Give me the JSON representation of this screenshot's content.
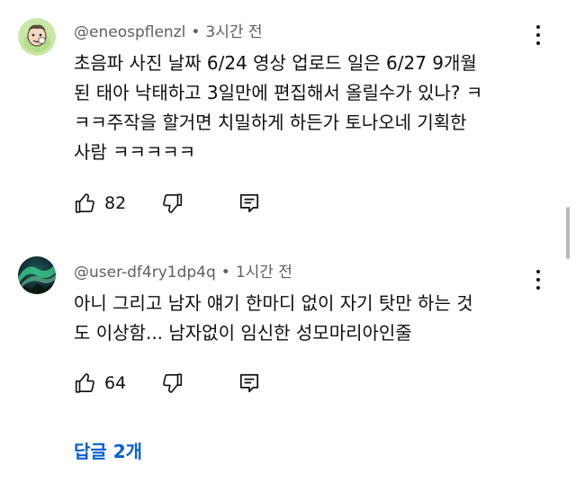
{
  "comments": [
    {
      "author": "@eneospflenzl",
      "separator": "•",
      "time": "3시간 전",
      "text": "초음파 사진 날짜 6/24 영상 업로드 일은 6/27 9개월\n된 태아 낙태하고 3일만에 편집해서 올릴수가 있나? ㅋ\nㅋㅋ주작을 할거면 치밀하게 하든가 토나오네 기획한\n사람 ㅋㅋㅋㅋㅋ",
      "likes": "82",
      "avatar_icon": "cartoon-face-avatar"
    },
    {
      "author": "@user-df4ry1dp4q",
      "separator": "•",
      "time": "1시간 전",
      "text": "아니 그리고 남자 얘기 한마디 없이 자기 탓만 하는 것\n도 이상함... 남자없이 임신한 성모마리아인줄",
      "likes": "64",
      "avatar_icon": "aurora-avatar"
    }
  ],
  "replies_label": "답글 2개",
  "colors": {
    "link": "#065fd4",
    "meta": "#606060",
    "text": "#0f0f0f"
  },
  "icons": [
    "like-icon",
    "dislike-icon",
    "reply-icon",
    "more-options-icon"
  ]
}
